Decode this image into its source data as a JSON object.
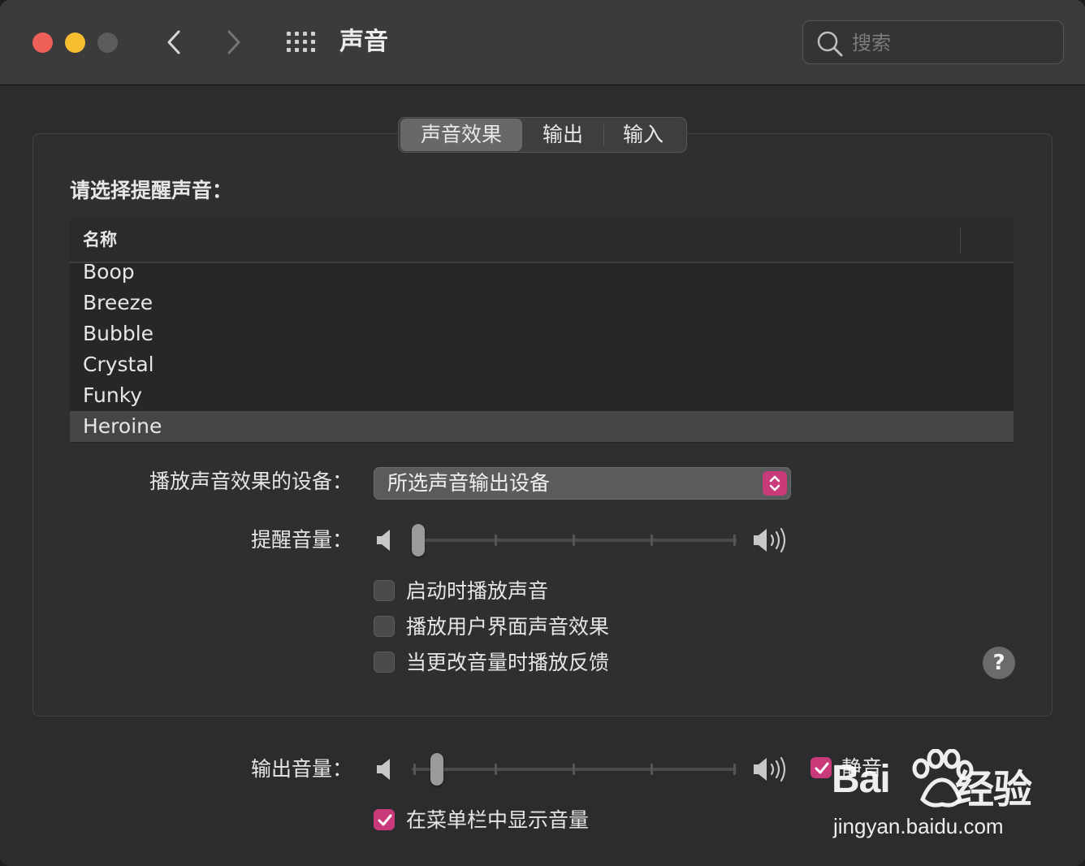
{
  "window": {
    "title": "声音",
    "search_placeholder": "搜索"
  },
  "tabs": [
    {
      "label": "声音效果",
      "selected": true
    },
    {
      "label": "输出",
      "selected": false
    },
    {
      "label": "输入",
      "selected": false
    }
  ],
  "sound_effects": {
    "alert_label": "请选择提醒声音：",
    "table_header": "名称",
    "sounds": [
      "Boop",
      "Breeze",
      "Bubble",
      "Crystal",
      "Funky",
      "Heroine"
    ],
    "selected_sound": "Heroine",
    "device_label": "播放声音效果的设备：",
    "device_value": "所选声音输出设备",
    "alert_volume_label": "提醒音量：",
    "alert_volume_level": 0.0,
    "checkboxes": [
      {
        "label": "启动时播放声音",
        "checked": false
      },
      {
        "label": "播放用户界面声音效果",
        "checked": false
      },
      {
        "label": "当更改音量时播放反馈",
        "checked": false
      }
    ],
    "help": "?"
  },
  "output": {
    "volume_label": "输出音量：",
    "volume_level": 0.06,
    "mute_label": "静音",
    "mute_checked": true,
    "show_in_menubar_label": "在菜单栏中显示音量",
    "show_in_menubar_checked": true
  },
  "watermark": {
    "logo_text": "Bai",
    "logo_text2": "经验",
    "url": "jingyan.baidu.com"
  },
  "colors": {
    "accent": "#c93a7a",
    "close": "#ee5f57",
    "minimize": "#f5bd2f",
    "zoom_disabled": "#5c5c5e"
  }
}
